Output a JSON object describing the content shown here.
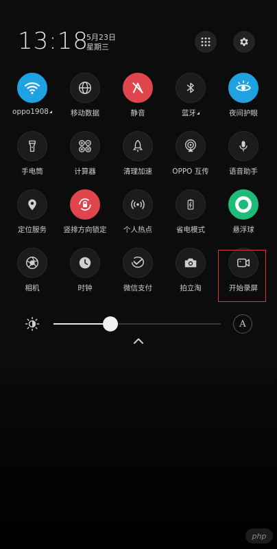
{
  "status": {
    "time": "13:18",
    "date": "5月23日",
    "weekday": "星期三"
  },
  "header": {
    "grid_icon": "grid-dots-icon",
    "settings_icon": "gear-icon"
  },
  "tiles": [
    {
      "label": "oppo1908",
      "icon": "wifi-icon",
      "state": "on-blue",
      "caret": true
    },
    {
      "label": "移动数据",
      "icon": "mobile-data-icon",
      "state": "off"
    },
    {
      "label": "静音",
      "icon": "mute-icon",
      "state": "on-red"
    },
    {
      "label": "蓝牙",
      "icon": "bluetooth-icon",
      "state": "off",
      "caret": true
    },
    {
      "label": "夜间护眼",
      "icon": "eye-care-icon",
      "state": "on-blue"
    },
    {
      "label": "手电筒",
      "icon": "flashlight-icon",
      "state": "off"
    },
    {
      "label": "计算器",
      "icon": "calculator-icon",
      "state": "off"
    },
    {
      "label": "清理加速",
      "icon": "rocket-icon",
      "state": "off"
    },
    {
      "label": "OPPO 互传",
      "icon": "share-icon",
      "state": "off"
    },
    {
      "label": "语音助手",
      "icon": "microphone-icon",
      "state": "off"
    },
    {
      "label": "定位服务",
      "icon": "location-icon",
      "state": "off"
    },
    {
      "label": "竖排方向锁定",
      "icon": "rotation-lock-icon",
      "state": "on-red"
    },
    {
      "label": "个人热点",
      "icon": "hotspot-icon",
      "state": "off"
    },
    {
      "label": "省电模式",
      "icon": "battery-saver-icon",
      "state": "off"
    },
    {
      "label": "悬浮球",
      "icon": "floating-ball-icon",
      "state": "on-green"
    },
    {
      "label": "相机",
      "icon": "camera-shutter-icon",
      "state": "off"
    },
    {
      "label": "时钟",
      "icon": "clock-icon",
      "state": "off"
    },
    {
      "label": "微信支付",
      "icon": "wechat-pay-icon",
      "state": "off"
    },
    {
      "label": "拍立淘",
      "icon": "photo-search-icon",
      "state": "off"
    },
    {
      "label": "开始录屏",
      "icon": "screen-record-icon",
      "state": "off"
    }
  ],
  "brightness": {
    "level": 0.34,
    "auto_label": "A"
  },
  "watermark": "php"
}
